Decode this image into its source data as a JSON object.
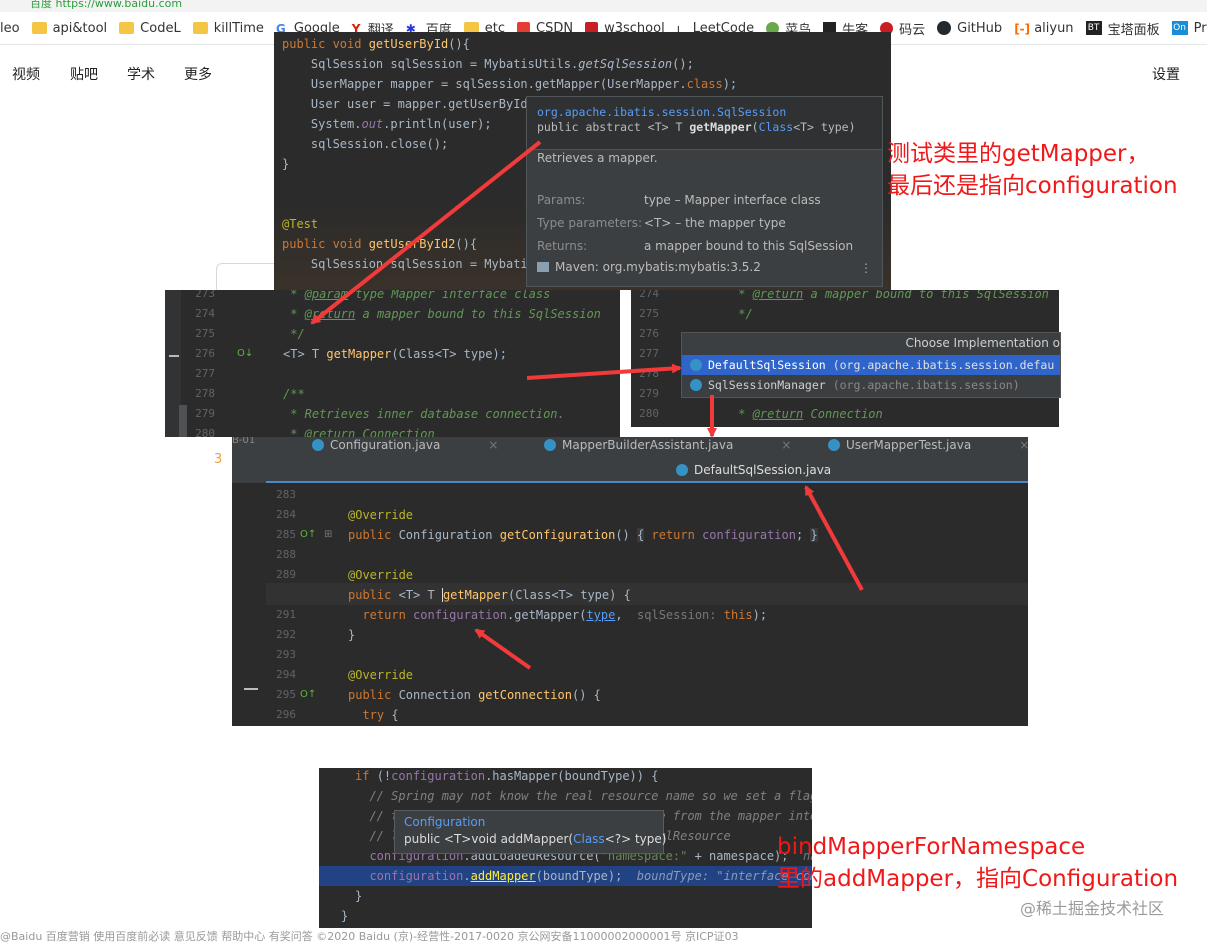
{
  "browser": {
    "url_partial": "百度 https://www.baidu.com",
    "bookmarks": [
      {
        "label": "leo",
        "icon": "none"
      },
      {
        "label": "api&tool",
        "icon": "folder"
      },
      {
        "label": "CodeL",
        "icon": "folder"
      },
      {
        "label": "killTime",
        "icon": "folder"
      },
      {
        "label": "Google",
        "icon": "google-icon"
      },
      {
        "label": "翻译",
        "icon": "translate-icon"
      },
      {
        "label": "百度",
        "icon": "baidu-icon"
      },
      {
        "label": "etc",
        "icon": "folder"
      },
      {
        "label": "CSDN",
        "icon": "csdn-icon"
      },
      {
        "label": "w3school",
        "icon": "w3-icon"
      },
      {
        "label": "LeetCode",
        "icon": "leetcode-icon"
      },
      {
        "label": "菜鸟",
        "icon": "runoob-icon"
      },
      {
        "label": "牛客",
        "icon": "nowcoder-icon"
      },
      {
        "label": "码云",
        "icon": "gitee-icon"
      },
      {
        "label": "GitHub",
        "icon": "github-icon"
      },
      {
        "label": "aliyun",
        "icon": "aliyun-icon"
      },
      {
        "label": "宝塔面板",
        "icon": "bt-icon"
      },
      {
        "label": "Process",
        "icon": "processon-icon"
      }
    ],
    "nav": [
      "视频",
      "贴吧",
      "学术",
      "更多"
    ],
    "settings": "设置",
    "footer": "@Baidu   百度营销   使用百度前必读   意见反馈   帮助中心   有奖问答        ©2020 Baidu   (京)-经营性-2017-0020   京公网安备11000002000001号   京ICP证03"
  },
  "panel1": {
    "lines": [
      "public void getUserById(){",
      "    SqlSession sqlSession = MybatisUtils.getSqlSession();",
      "    UserMapper mapper = sqlSession.getMapper(UserMapper.class);",
      "    User user = mapper.getUserById(",
      "    System.out.println(user);",
      "    sqlSession.close();",
      "}",
      "",
      "",
      "@Test",
      "public void getUserById2(){",
      "    SqlSession sqlSession = Mybatis"
    ]
  },
  "doc_popup": {
    "qualified": "org.apache.ibatis.session.SqlSession",
    "signature": "public abstract <T> T getMapper(Class<T> type)",
    "description": "Retrieves a mapper.",
    "params_label": "Params:",
    "params_value": "type – Mapper interface class",
    "type_params_label": "Type parameters:",
    "type_params_value": "<T> – the mapper type",
    "returns_label": "Returns:",
    "returns_value": "a mapper bound to this SqlSession",
    "maven": "Maven: org.mybatis:mybatis:3.5.2",
    "more": "⋮"
  },
  "note1": {
    "line1": "测试类里的getMapper，",
    "line2": "最后还是指向configuration"
  },
  "panel2": {
    "gutter": [
      "273",
      "274",
      "275",
      "276",
      "277",
      "278",
      "279",
      "280"
    ],
    "lines": [
      " * @param type Mapper interface class",
      " * @return a mapper bound to this SqlSession",
      " */",
      "<T> T getMapper(Class<T> type);",
      "",
      "/**",
      " * Retrieves inner database connection.",
      " * @return Connection"
    ]
  },
  "panel3": {
    "gutter": [
      "274",
      "275",
      "276",
      "277",
      "278",
      "279",
      "280"
    ],
    "lines": [
      " * @return a mapper bound to this SqlSession",
      " */",
      "<T> T getMapper(Class<T> type);",
      "",
      "",
      "",
      " * @return Connection"
    ],
    "chooser_title": "Choose Implementation o",
    "impl1": "DefaultSqlSession",
    "impl1_pkg": "(org.apache.ibatis.session.defau",
    "impl2": "SqlSessionManager",
    "impl2_pkg": "(org.apache.ibatis.session)"
  },
  "panel4": {
    "tab1": "Configuration.java",
    "tab2": "MapperBuilderAssistant.java",
    "tab3": "UserMapperTest.java",
    "active_tab": "DefaultSqlSession.java",
    "gutter": [
      "283",
      "284",
      "285",
      "288",
      "289",
      "290",
      "291",
      "292",
      "293",
      "294",
      "295",
      "296"
    ],
    "lines": [
      "",
      "@Override",
      "public Configuration getConfiguration() { return configuration; }",
      "",
      "@Override",
      "public <T> T getMapper(Class<T> type) {",
      "  return configuration.getMapper(type,  sqlSession: this);",
      "}",
      "",
      "@Override",
      "public Connection getConnection() {",
      "  try {"
    ],
    "side_number": "3",
    "side_label": "B-01"
  },
  "panel5": {
    "lines": [
      "if (!configuration.hasMapper(boundType)) {",
      "  // Spring may not know the real resource name so we set a flag",
      "  // to prevent loading again this resource from the mapper inter",
      "  // look at MapperAnnotationBuilder#loadXmlResource",
      "  configuration.addLoadedResource(\"namespace:\" + namespace);  nam",
      "  configuration.addMapper(boundType);  boundType: \"interface com",
      "}",
      "}"
    ],
    "tooltip_title": "Configuration",
    "tooltip_sig": "public <T>void addMapper(Class<?> type)"
  },
  "note2": {
    "line1": "bindMapperForNamespace",
    "line2": "里的addMapper，指向Configuration"
  },
  "watermark": "@稀土掘金技术社区",
  "colors": {
    "arrow": "#f23a3a",
    "note": "#f01818",
    "ide_bg": "#2b2b2b",
    "selection": "#2f65ca"
  }
}
